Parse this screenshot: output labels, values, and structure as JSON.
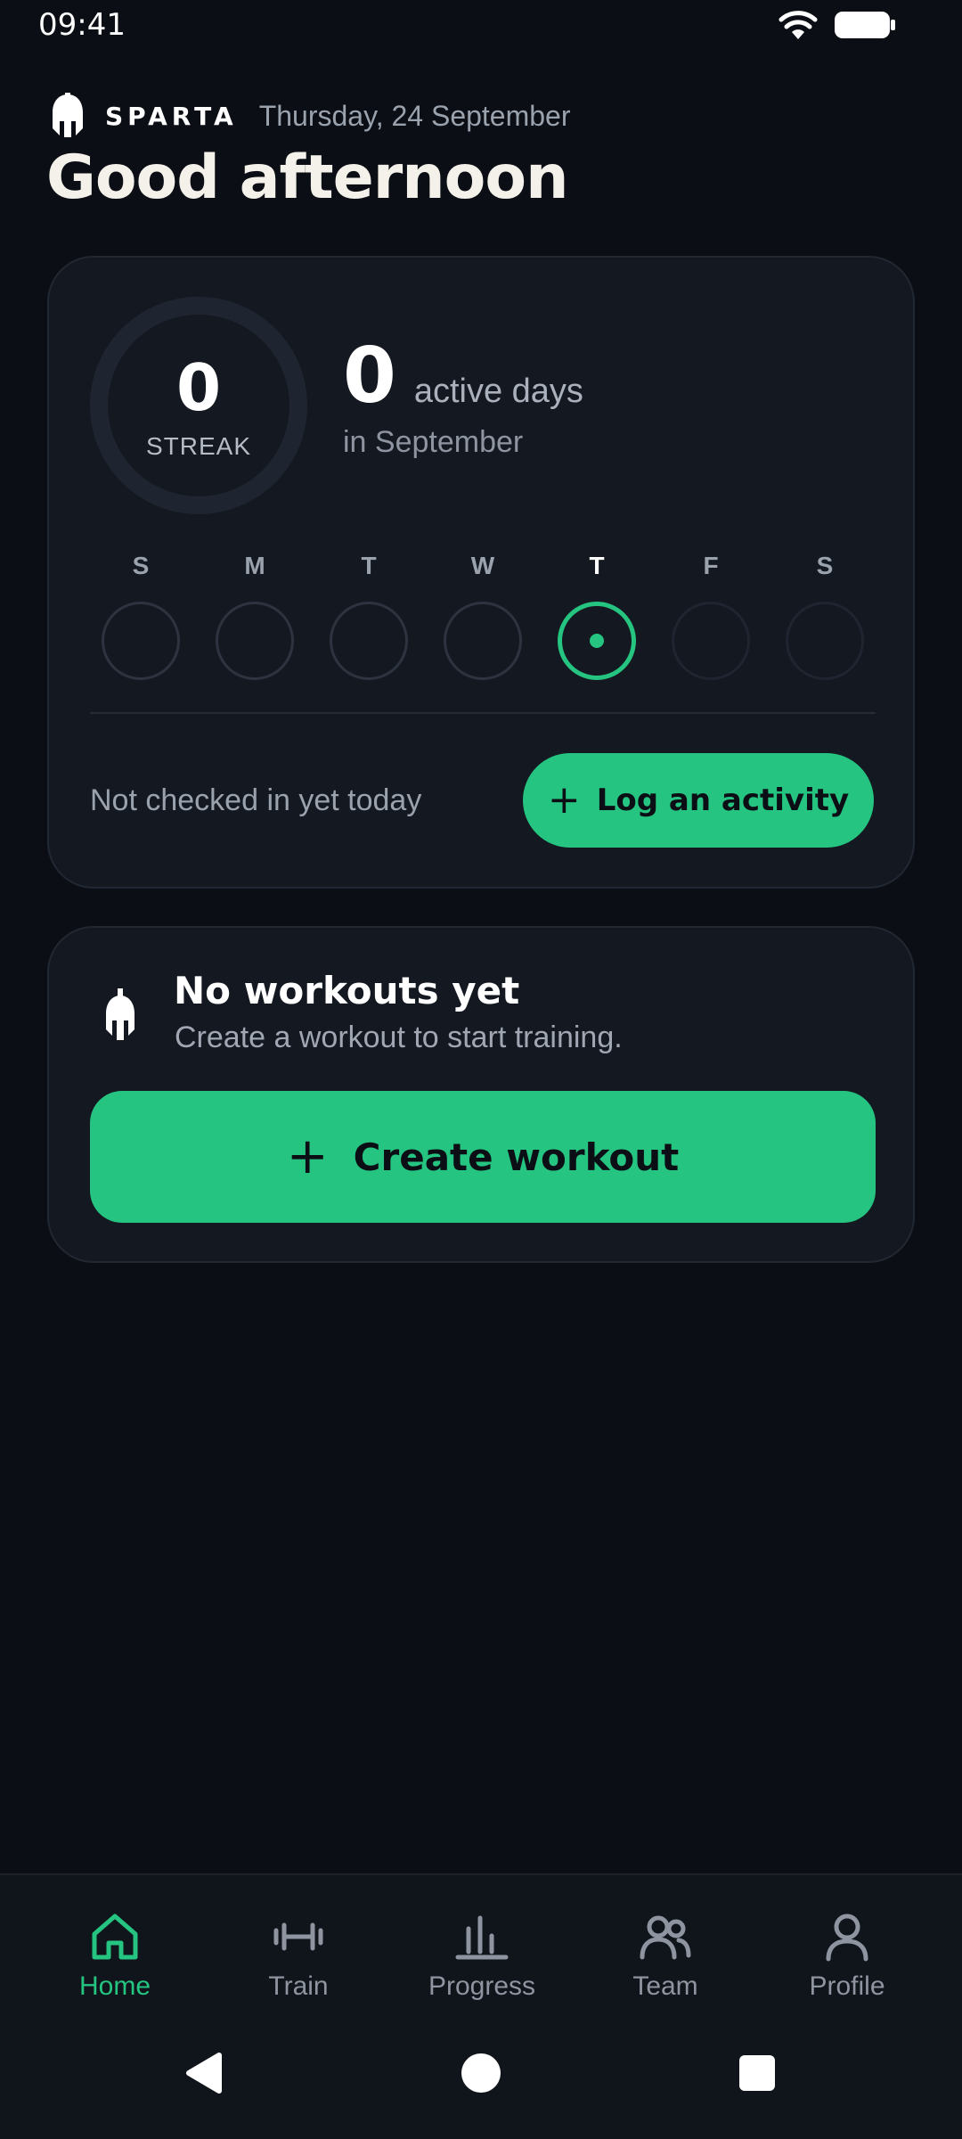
{
  "status_bar": {
    "time": "09:41"
  },
  "header": {
    "brand": "SPARTA",
    "date": "Thursday, 24 September",
    "greeting": "Good afternoon"
  },
  "streak_card": {
    "streak_value": "0",
    "streak_label": "STREAK",
    "active_count": "0",
    "active_label": "active days",
    "active_sub": "in September",
    "week": [
      {
        "letter": "S",
        "state": "past"
      },
      {
        "letter": "M",
        "state": "past"
      },
      {
        "letter": "T",
        "state": "past"
      },
      {
        "letter": "W",
        "state": "past"
      },
      {
        "letter": "T",
        "state": "today"
      },
      {
        "letter": "F",
        "state": "future"
      },
      {
        "letter": "S",
        "state": "future"
      }
    ],
    "checkin_text": "Not checked in yet today",
    "log_button": "Log an activity"
  },
  "workout_card": {
    "title": "No workouts yet",
    "subtitle": "Create a workout to start training.",
    "create_button": "Create workout"
  },
  "bottom_nav": {
    "items": [
      {
        "label": "Home",
        "icon": "home-icon",
        "active": true
      },
      {
        "label": "Train",
        "icon": "dumbbell-icon",
        "active": false
      },
      {
        "label": "Progress",
        "icon": "bar-chart-icon",
        "active": false
      },
      {
        "label": "Team",
        "icon": "team-icon",
        "active": false
      },
      {
        "label": "Profile",
        "icon": "profile-icon",
        "active": false
      }
    ]
  },
  "colors": {
    "background": "#0b0e14",
    "card": "#141820",
    "accent": "#25c581",
    "muted_text": "#9aa2ae"
  }
}
